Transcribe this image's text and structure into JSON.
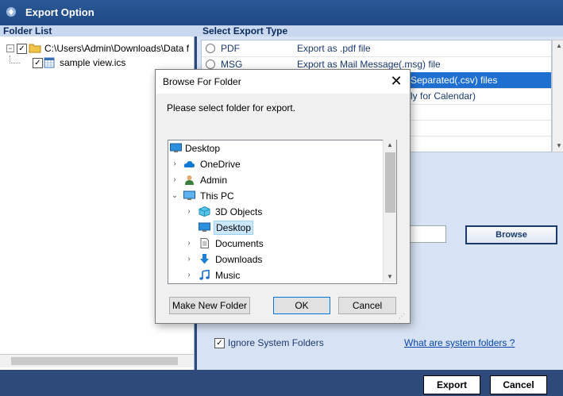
{
  "window": {
    "title": "Export Option"
  },
  "folder_list": {
    "header": "Folder List",
    "items": [
      {
        "label": "C:\\Users\\Admin\\Downloads\\Data f",
        "checked": true,
        "expander": "−"
      },
      {
        "label": "sample view.ics",
        "checked": true
      }
    ]
  },
  "export_type": {
    "header": "Select Export Type",
    "options": [
      {
        "name": "PDF",
        "description": "Export as .pdf file"
      },
      {
        "name": "MSG",
        "description": "Export as Mail Message(.msg) file"
      },
      {
        "name": "",
        "description": "Separated(.csv) files",
        "selected": true
      },
      {
        "name": "",
        "description": "ly for Calendar)"
      },
      {
        "name": "",
        "description": ""
      },
      {
        "name": "",
        "description": ""
      },
      {
        "name": "",
        "description": ""
      }
    ]
  },
  "destination": {
    "browse_label": "Browse",
    "path_value": ""
  },
  "ignore": {
    "label": "Ignore System Folders",
    "checked": true,
    "link": "What are system folders ?"
  },
  "footer": {
    "export_label": "Export",
    "cancel_label": "Cancel"
  },
  "dialog": {
    "title": "Browse For Folder",
    "close_glyph": "✕",
    "message": "Please select folder for export.",
    "tree": [
      {
        "label": "Desktop",
        "icon": "desktop-icon",
        "chevron": ""
      },
      {
        "label": "OneDrive",
        "icon": "cloud-icon",
        "chevron": "›"
      },
      {
        "label": "Admin",
        "icon": "user-icon",
        "chevron": "›"
      },
      {
        "label": "This PC",
        "icon": "pc-icon",
        "chevron": "⌄"
      },
      {
        "label": "3D Objects",
        "icon": "cube-icon",
        "chevron": "›"
      },
      {
        "label": "Desktop",
        "icon": "desktop-icon",
        "chevron": "",
        "selected": true
      },
      {
        "label": "Documents",
        "icon": "document-icon",
        "chevron": "›"
      },
      {
        "label": "Downloads",
        "icon": "download-icon",
        "chevron": "›"
      },
      {
        "label": "Music",
        "icon": "music-icon",
        "chevron": "›"
      }
    ],
    "new_folder_label": "Make New Folder",
    "ok_label": "OK",
    "cancel_label": "Cancel"
  },
  "colors": {
    "accent": "#1e6fd0",
    "titlebar": "#1f4a86",
    "selection_bg": "#cce8ff"
  }
}
